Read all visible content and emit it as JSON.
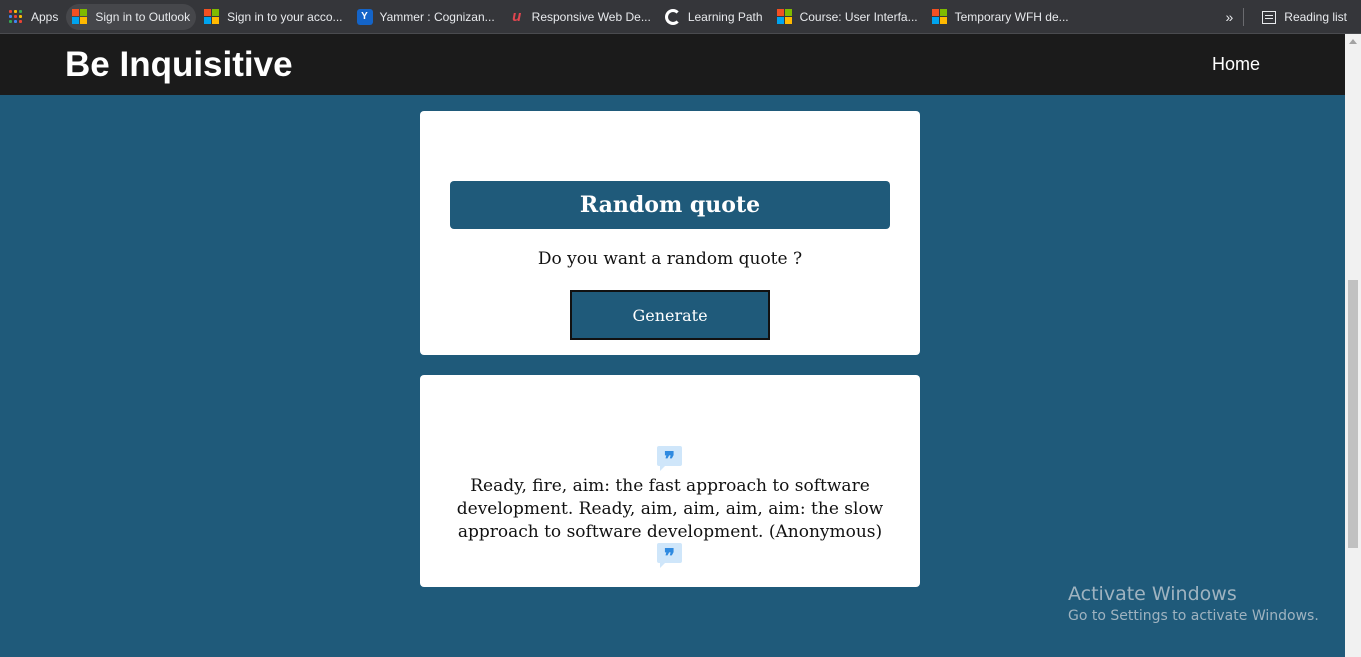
{
  "bookmarks": {
    "items": [
      {
        "label": "Apps",
        "icon": "apps-grid-icon"
      },
      {
        "label": "Sign in to Outlook",
        "icon": "microsoft-icon"
      },
      {
        "label": "Sign in to your acco...",
        "icon": "microsoft-icon"
      },
      {
        "label": "Yammer : Cognizan...",
        "icon": "yammer-icon"
      },
      {
        "label": "Responsive Web De...",
        "icon": "udemy-icon"
      },
      {
        "label": "Learning Path",
        "icon": "learning-path-icon"
      },
      {
        "label": "Course: User Interfa...",
        "icon": "microsoft-icon"
      },
      {
        "label": "Temporary WFH de...",
        "icon": "microsoft-icon"
      }
    ],
    "overflow": "»",
    "reading_list": "Reading list"
  },
  "navbar": {
    "brand": "Be Inquisitive",
    "home": "Home"
  },
  "generator": {
    "title": "Random quote",
    "prompt": "Do you want a random quote ?",
    "button": "Generate"
  },
  "quote": {
    "open_mark": "❞",
    "text": "Ready, fire, aim: the fast approach to software development. Ready, aim, aim, aim, aim: the slow approach to software development. (Anonymous)",
    "close_mark": "❞"
  },
  "watermark": {
    "title": "Activate Windows",
    "subtitle": "Go to Settings to activate Windows."
  },
  "colors": {
    "page_bg": "#1f5a7a",
    "navbar_bg": "#1b1b1b",
    "card_bg": "#ffffff",
    "quote_icon": "#2f8ae0"
  }
}
